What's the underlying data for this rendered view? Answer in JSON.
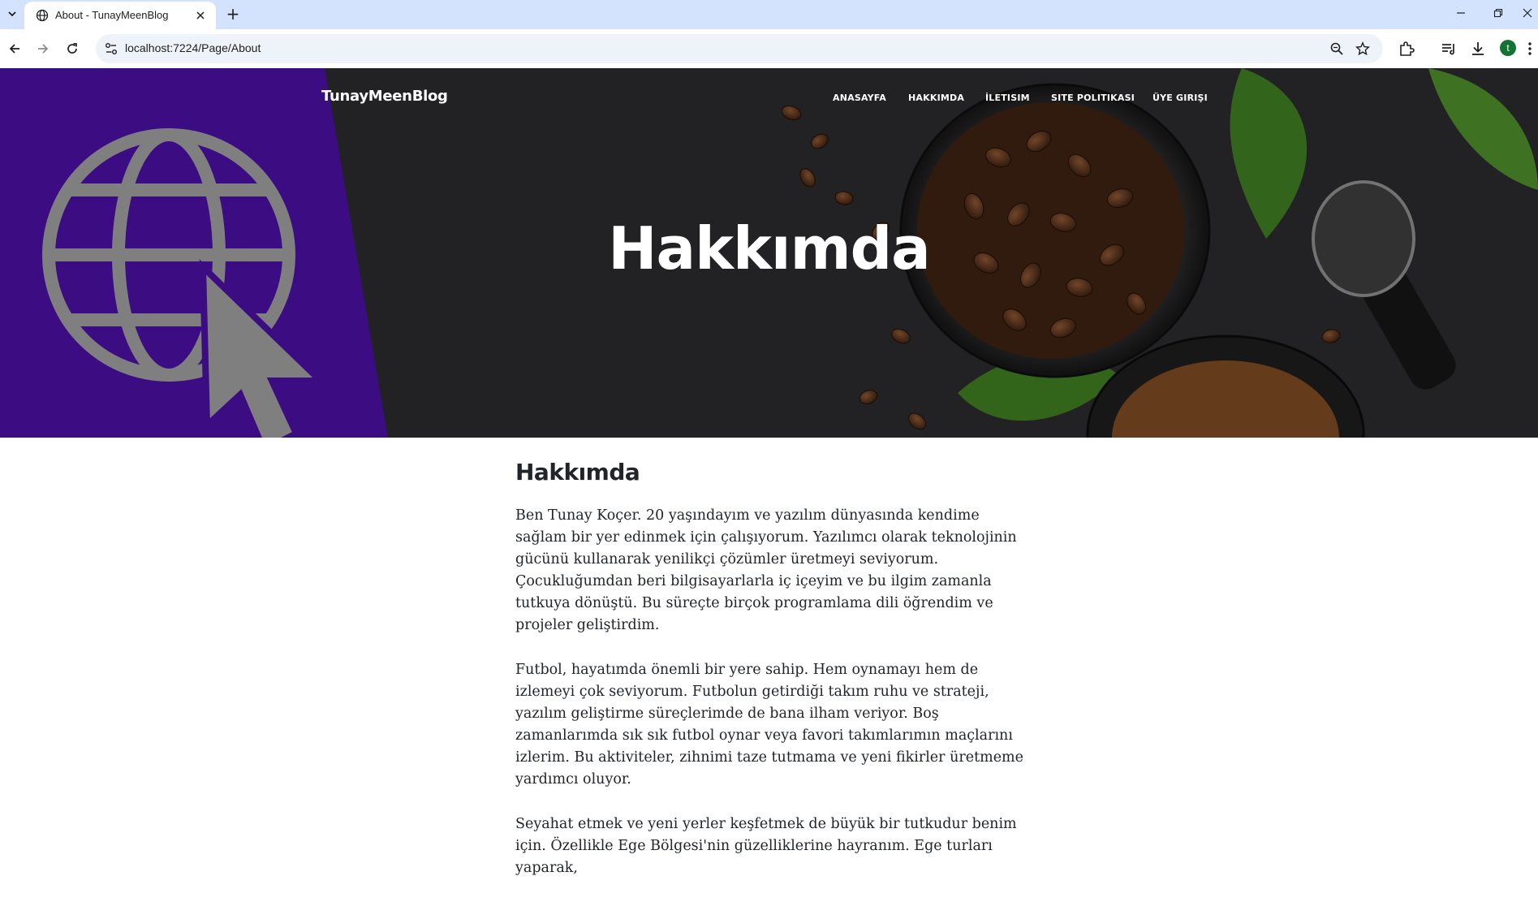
{
  "browser": {
    "tab": {
      "title": "About - TunayMeenBlog"
    },
    "new_tab_symbol": "+",
    "url": "localhost:7224/Page/About",
    "profile_initial": "t",
    "icons": [
      "chevron-down-icon",
      "globe-icon",
      "close-icon",
      "plus-icon",
      "minimize-icon",
      "restore-icon",
      "close-window-icon",
      "back-arrow-icon",
      "forward-arrow-icon",
      "reload-icon",
      "site-info-icon",
      "zoom-icon",
      "star-icon",
      "extensions-icon",
      "media-icon",
      "download-icon",
      "menu-dots-icon"
    ]
  },
  "site": {
    "brand": "TunayMeenBlog",
    "nav": [
      "ANASAYFA",
      "HAKKIMDA",
      "İLETISIM",
      "SITE POLITIKASI",
      "ÜYE GIRIŞI"
    ],
    "hero_title": "Hakkımda",
    "hero_colors": {
      "left_panel": "#4a0fa0",
      "background": "#232325"
    }
  },
  "content": {
    "heading": "Hakkımda",
    "paragraphs": [
      "Ben Tunay Koçer. 20 yaşındayım ve yazılım dünyasında kendime sağlam bir yer edinmek için çalışıyorum. Yazılımcı olarak teknolojinin gücünü kullanarak yenilikçi çözümler üretmeyi seviyorum. Çocukluğumdan beri bilgisayarlarla iç içeyim ve bu ilgim zamanla tutkuya dönüştü. Bu süreçte birçok programlama dili öğrendim ve projeler geliştirdim.",
      "Futbol, hayatımda önemli bir yere sahip. Hem oynamayı hem de izlemeyi çok seviyorum. Futbolun getirdiği takım ruhu ve strateji, yazılım geliştirme süreçlerimde de bana ilham veriyor. Boş zamanlarımda sık sık futbol oynar veya favori takımlarımın maçlarını izlerim. Bu aktiviteler, zihnimi taze tutmama ve yeni fikirler üretmeme yardımcı oluyor.",
      "Seyahat etmek ve yeni yerler keşfetmek de büyük bir tutkudur benim için. Özellikle Ege Bölgesi'nin güzelliklerine hayranım. Ege turları yaparak,"
    ]
  }
}
